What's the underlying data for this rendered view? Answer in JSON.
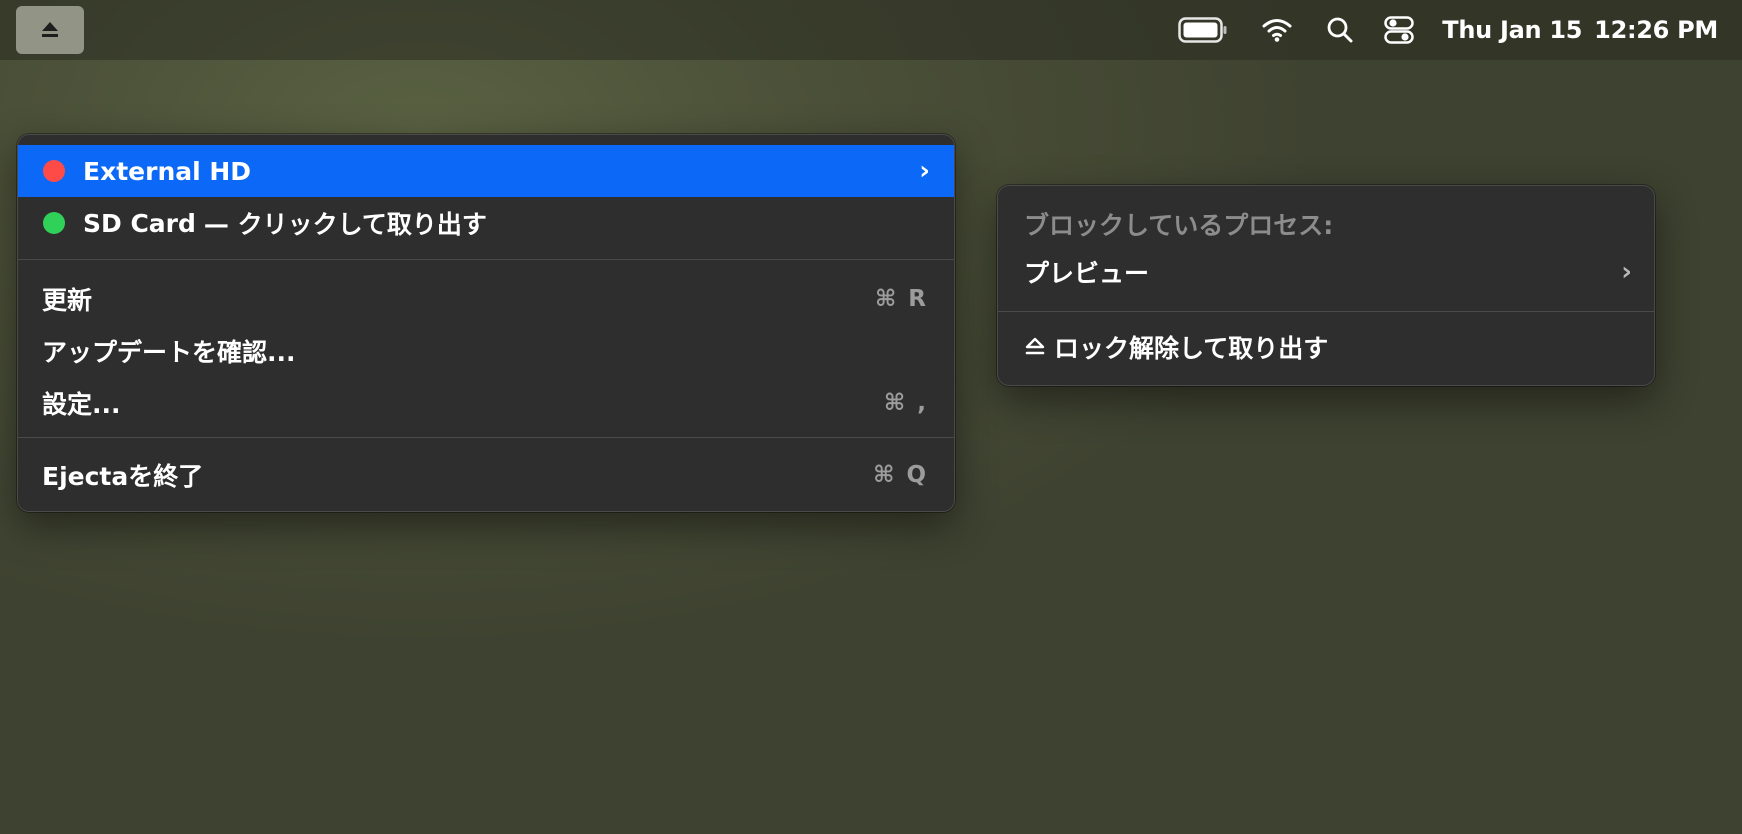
{
  "menubar": {
    "eject_icon": "eject-icon",
    "battery_icon": "battery-icon",
    "wifi_icon": "wifi-icon",
    "search_icon": "search-icon",
    "control_center_icon": "control-center-icon",
    "date": "Thu Jan 15",
    "time": "12:26 PM"
  },
  "main_menu": {
    "drives": [
      {
        "name": "External HD",
        "status_color": "#ff4b47",
        "highlighted": true,
        "has_submenu": true
      },
      {
        "name": "SD Card",
        "action_suffix": "— クリックして取り出す",
        "status_color": "#30d158",
        "highlighted": false,
        "has_submenu": false
      }
    ],
    "refresh": {
      "label": "更新",
      "shortcut": "⌘ R"
    },
    "check_updates": {
      "label": "アップデートを確認..."
    },
    "settings": {
      "label": "設定...",
      "shortcut": "⌘ ,"
    },
    "quit": {
      "label": "Ejectaを終了",
      "shortcut": "⌘ Q"
    }
  },
  "submenu": {
    "heading": "ブロックしているプロセス:",
    "process": {
      "label": "プレビュー"
    },
    "unlock_eject": {
      "label": "ロック解除して取り出す"
    }
  },
  "colors": {
    "highlight": "#0c68f6",
    "menu_background": "#2e2e2e"
  }
}
